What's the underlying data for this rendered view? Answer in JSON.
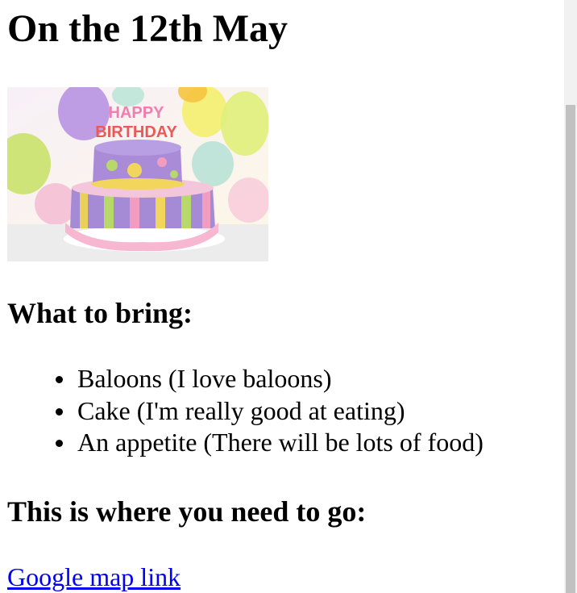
{
  "page": {
    "title": "On the 12th May",
    "image": {
      "topper_text": "HAPPY BIRTHDAY",
      "topper_line1": "HAPPY",
      "topper_line2": "BIRTHDAY"
    },
    "bring_heading": "What to bring:",
    "bring_items": [
      "Baloons (I love baloons)",
      "Cake (I'm really good at eating)",
      "An appetite (There will be lots of food)"
    ],
    "go_heading": "This is where you need to go:",
    "map_link_label": "Google map link"
  },
  "colors": {
    "link": "#0000ee",
    "text": "#000000",
    "scrollbar_track": "#f1f1f1",
    "scrollbar_thumb": "#c1c1c1"
  }
}
